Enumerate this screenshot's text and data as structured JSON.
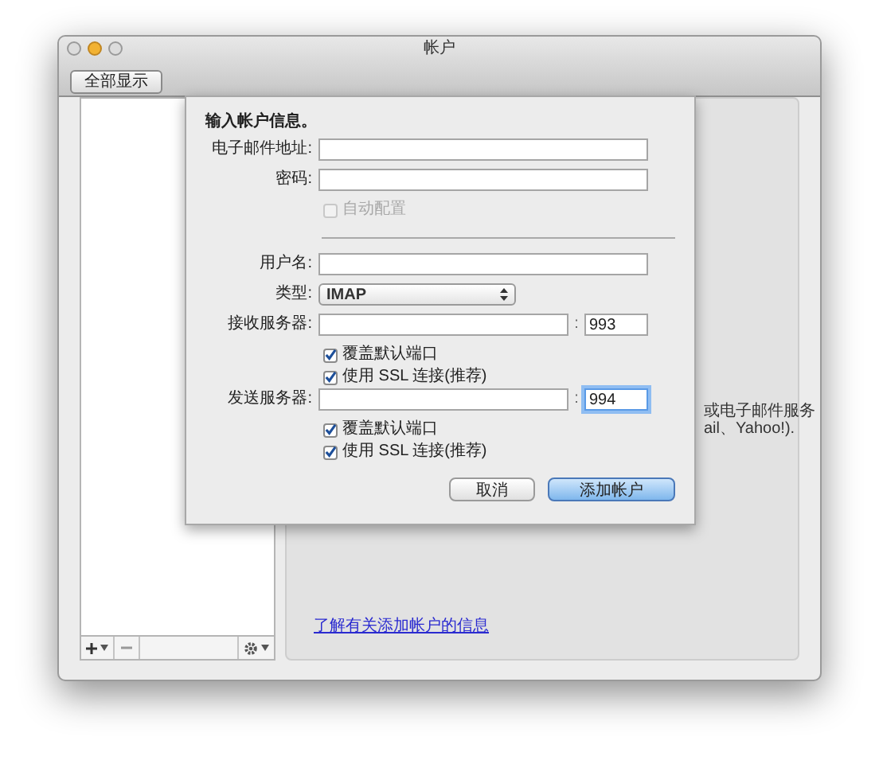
{
  "window": {
    "title": "帐户",
    "toolbar_button": "全部显示"
  },
  "right_panel": {
    "background_fragments": [
      "或电子邮件服务",
      "ail、Yahoo!)."
    ],
    "link": "了解有关添加帐户的信息"
  },
  "sheet": {
    "heading": "输入帐户信息。",
    "fields": [
      {
        "kind": "text",
        "label": "电子邮件地址:"
      },
      {
        "kind": "text",
        "label": "密码:"
      },
      {
        "kind": "checkbox",
        "label": "自动配置",
        "checked": false,
        "disabled": true
      },
      {
        "kind": "separator"
      },
      {
        "kind": "text",
        "label": "用户名:"
      },
      {
        "kind": "popup",
        "label": "类型:",
        "value": "IMAP"
      },
      {
        "kind": "server",
        "label": "接收服务器:",
        "port_separator": ":",
        "port": "993",
        "focused": false
      },
      {
        "kind": "checkbox",
        "label": "覆盖默认端口",
        "checked": true,
        "disabled": false
      },
      {
        "kind": "checkbox",
        "label": "使用 SSL 连接(推荐)",
        "checked": true,
        "disabled": false
      },
      {
        "kind": "server",
        "label": "发送服务器:",
        "port_separator": ":",
        "port": "994",
        "focused": true
      },
      {
        "kind": "checkbox",
        "label": "覆盖默认端口",
        "checked": true,
        "disabled": false
      },
      {
        "kind": "checkbox",
        "label": "使用 SSL 连接(推荐)",
        "checked": true,
        "disabled": false
      }
    ],
    "buttons": [
      {
        "label": "取消",
        "default": false
      },
      {
        "label": "添加帐户",
        "default": true
      }
    ]
  }
}
